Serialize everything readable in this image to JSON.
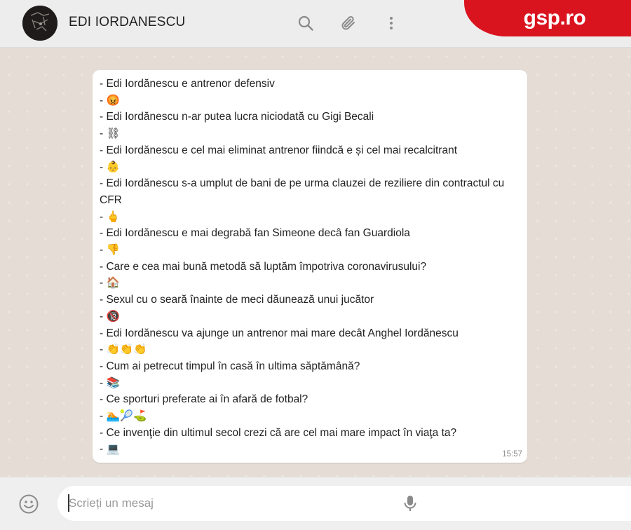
{
  "header": {
    "contact_name": "EDI IORDANESCU",
    "brand": "gsp.ro",
    "icons": [
      "search-icon",
      "attach-icon",
      "menu-icon"
    ]
  },
  "message": {
    "lines": [
      "- Edi Iordănescu e antrenor defensiv",
      "- 😡",
      "- Edi Iordănescu n-ar putea lucra niciodată cu Gigi Becali",
      "- ⛓",
      "- Edi Iordănescu e cel mai eliminat antrenor fiindcă e și cel mai recalcitrant",
      "- 👶",
      "- Edi Iordănescu s-a umplut de bani de pe urma clauzei de reziliere din contractul cu CFR",
      "- 🖕",
      "- Edi Iordănescu e mai degrabă fan Simeone decâ fan Guardiola",
      "- 👎",
      "- Care e cea mai bună metodă să luptăm împotriva coronavirusului?",
      "- 🏠",
      "- Sexul cu o seară înainte de meci dăunează unui jucător",
      "- 🔞",
      "- Edi Iordănescu va ajunge un antrenor mai mare decât Anghel Iordănescu",
      "- 👏👏👏",
      "- Cum ai petrecut timpul în casă în ultima săptămână?",
      "- 📚",
      "- Ce sporturi preferate ai în afară de fotbal?",
      "- 🏊🎾⛳",
      "- Ce invenţie din ultimul secol  crezi că are cel mai mare impact în viaţa ta?",
      "- 💻"
    ],
    "time": "15:57"
  },
  "composer": {
    "placeholder": "Scrieți un mesaj",
    "value": ""
  },
  "colors": {
    "brand_red": "#d9141f",
    "header_bg": "#ededed",
    "wallpaper": "#e5ddd5",
    "bubble_bg": "#ffffff",
    "icon_gray": "#8a8a8a"
  }
}
